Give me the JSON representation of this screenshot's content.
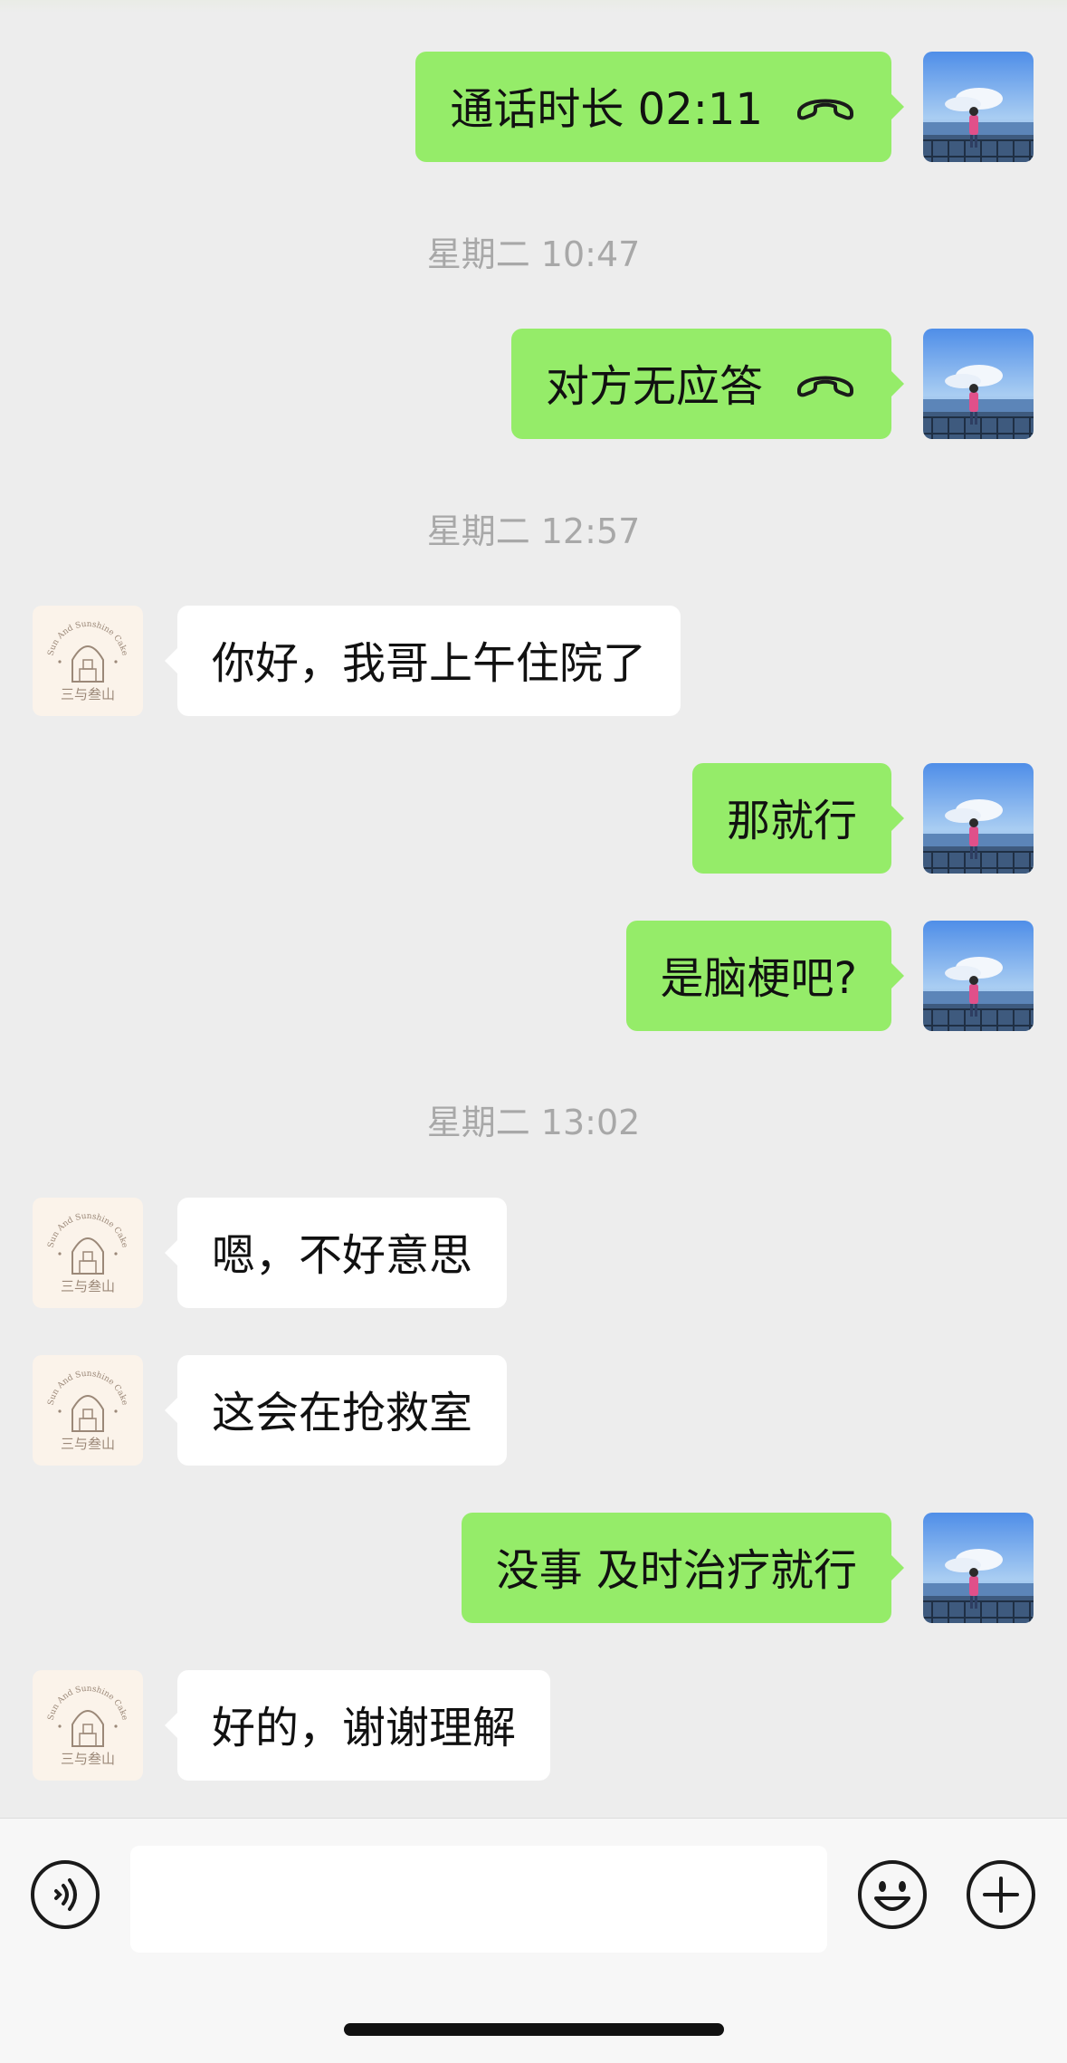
{
  "messages": [
    {
      "side": "self",
      "text": "通话时长 02:11",
      "call": true
    },
    {
      "timestamp": "星期二 10:47"
    },
    {
      "side": "self",
      "text": "对方无应答",
      "call": true
    },
    {
      "timestamp": "星期二 12:57"
    },
    {
      "side": "other",
      "text": "你好，我哥上午住院了"
    },
    {
      "side": "self",
      "text": "那就行"
    },
    {
      "side": "self",
      "text": "是脑梗吧?"
    },
    {
      "timestamp": "星期二 13:02"
    },
    {
      "side": "other",
      "text": "嗯，不好意思"
    },
    {
      "side": "other",
      "text": "这会在抢救室"
    },
    {
      "side": "self",
      "text": "没事 及时治疗就行"
    },
    {
      "side": "other",
      "text": "好的，谢谢理解"
    }
  ],
  "contact_avatar": {
    "line1": "Sun And Sunshine Cake",
    "line2": "三与叁山"
  },
  "input": {
    "placeholder": ""
  },
  "colors": {
    "self_bubble": "#95ec69",
    "other_bubble": "#ffffff",
    "background": "#ededed"
  },
  "icons": {
    "voice": "voice-mode-icon",
    "emoji": "emoji-icon",
    "plus": "plus-icon",
    "call": "phone-hangup-icon"
  }
}
